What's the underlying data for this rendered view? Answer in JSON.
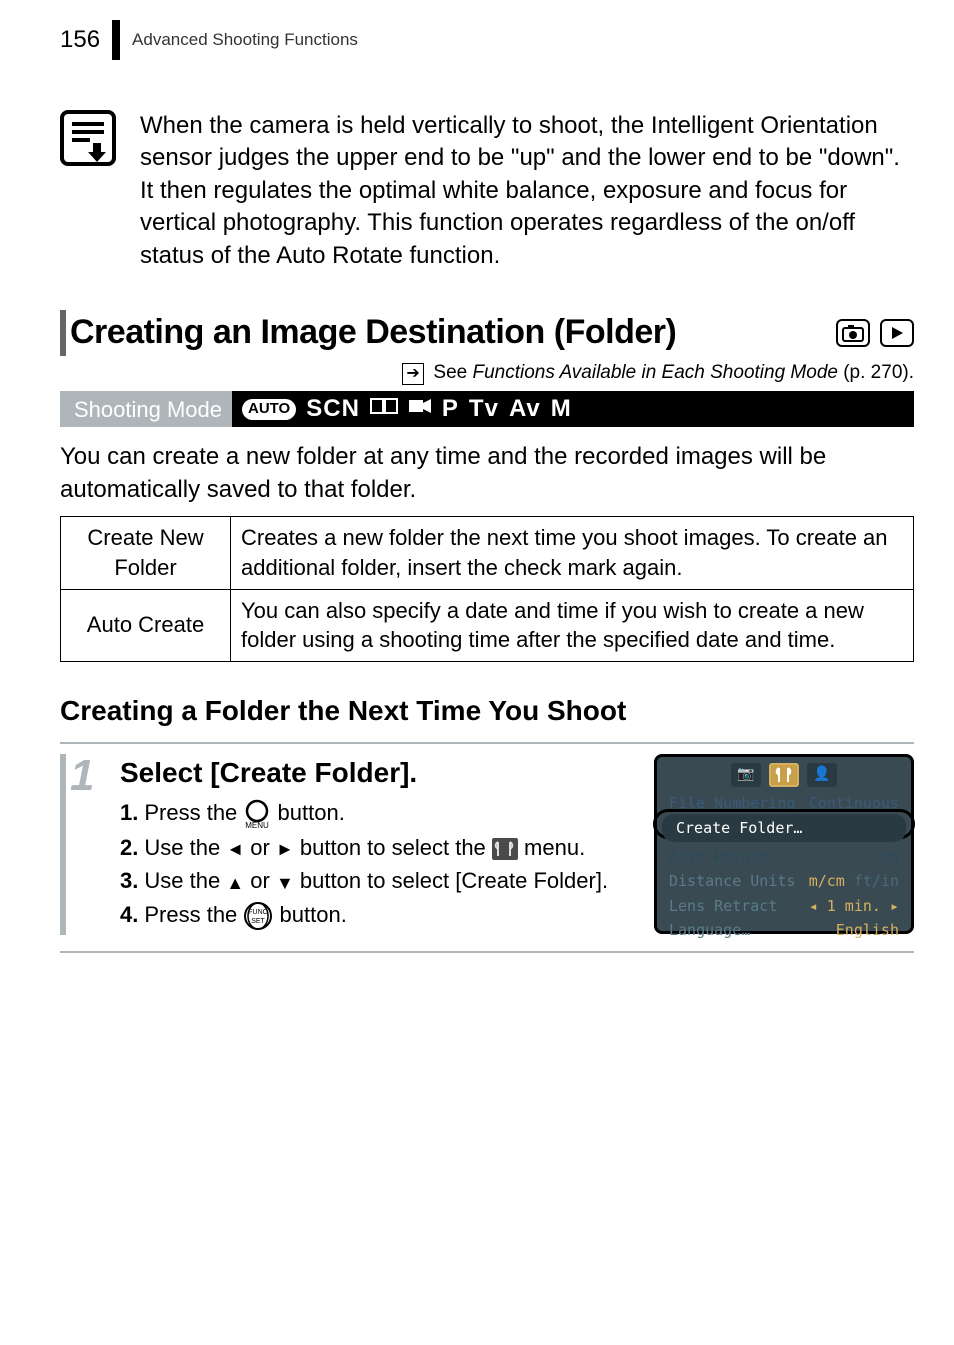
{
  "header": {
    "page": "156",
    "section": "Advanced Shooting Functions"
  },
  "note": "When the camera is held vertically to shoot, the Intelligent Orientation sensor judges the upper end to be \"up\" and the lower end to be \"down\". It then regulates the optimal white balance, exposure and focus for vertical photography. This function operates regardless of the on/off status of the Auto Rotate function.",
  "h2": "Creating an Image Destination (Folder)",
  "see_prefix": "See ",
  "see_em": "Functions Available in Each Shooting Mode",
  "see_suffix": " (p. 270).",
  "mode_label": "Shooting Mode",
  "mode_icons": {
    "auto": "AUTO",
    "scn": "SCN",
    "p": "P",
    "tv": "Tv",
    "av": "Av",
    "m": "M"
  },
  "intro": "You can create a new folder at any time and the recorded images will be automatically saved to that folder.",
  "table": {
    "r1": {
      "label": "Create New Folder",
      "desc": "Creates a new folder the next time you shoot images. To create an additional folder, insert the check mark again."
    },
    "r2": {
      "label": "Auto Create",
      "desc": "You can also specify a date and time if you wish to create a new folder using a shooting time after the specified date and time."
    }
  },
  "h3": "Creating a Folder the Next Time You Shoot",
  "step": {
    "num": "1",
    "title": "Select [Create Folder].",
    "l1": {
      "n": "1.",
      "a": "Press the ",
      "b": " button."
    },
    "l2": {
      "n": "2.",
      "a": "Use the ",
      "mid": " or ",
      "b": " button to select the ",
      "c": " menu."
    },
    "l3": {
      "n": "3.",
      "a": "Use the ",
      "mid": " or ",
      "b": " button to select [Create Folder]."
    },
    "l4": {
      "n": "4.",
      "a": "Press the ",
      "b": " button."
    }
  },
  "screen": {
    "row1": {
      "l": "File Numbering",
      "r": "Continuous"
    },
    "hl": "Create Folder…",
    "row2": {
      "l": "Auto Rotate",
      "r": "On"
    },
    "row3": {
      "l": "Distance Units",
      "r1": "m/cm",
      "r2": "ft/in"
    },
    "row4": {
      "l": "Lens Retract",
      "r": "1 min."
    },
    "row5": {
      "l": "Language…",
      "r": "English"
    }
  }
}
